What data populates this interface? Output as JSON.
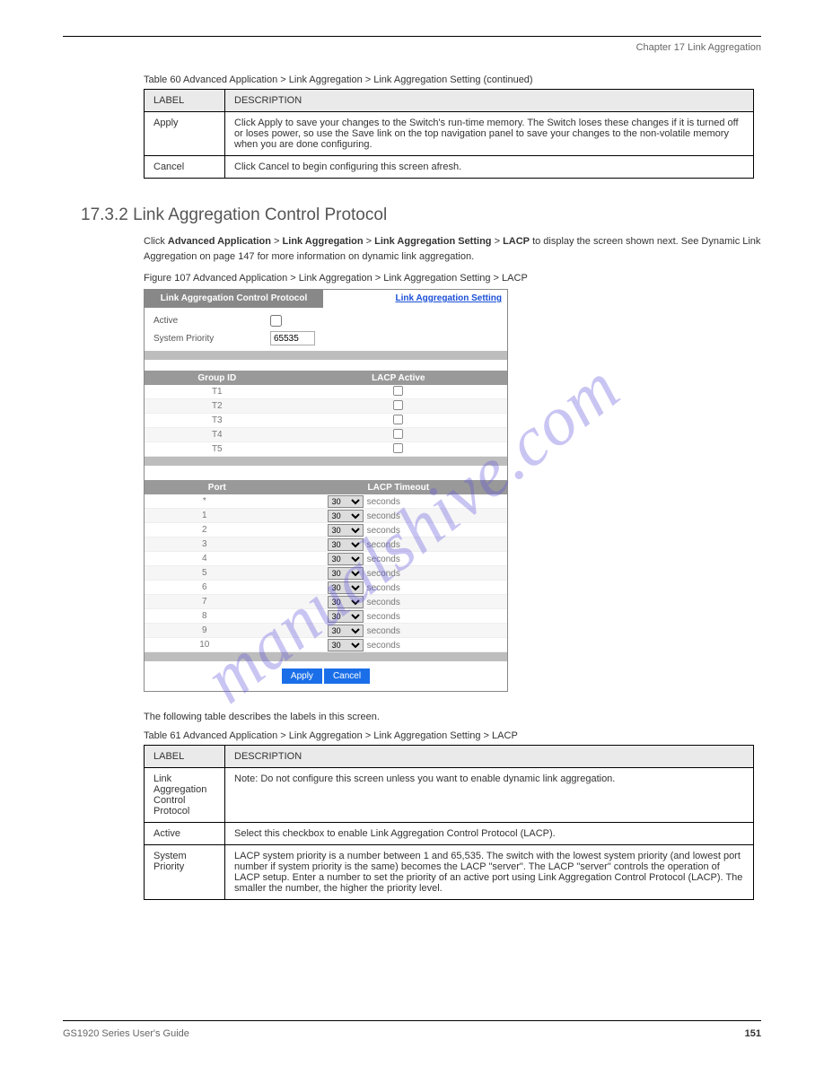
{
  "header": {
    "chapter": "Chapter 17 Link Aggregation"
  },
  "table_top": {
    "caption": "Table 60   Advanced Application > Link Aggregation > Link Aggregation Setting (continued)",
    "cols": [
      "LABEL",
      "DESCRIPTION"
    ],
    "rows": [
      {
        "label": "Apply",
        "desc": "Click Apply to save your changes to the Switch's run-time memory. The Switch loses these changes if it is turned off or loses power, so use the Save link on the top navigation panel to save your changes to the non-volatile memory when you are done configuring."
      },
      {
        "label": "Cancel",
        "desc": "Click Cancel to begin configuring this screen afresh."
      }
    ]
  },
  "section": {
    "number": "17.3.2  Link Aggregation Control Protocol",
    "body_before": "Click ",
    "body_bold1": "Advanced Application",
    "body_mid1": " > ",
    "body_bold2": "Link Aggregation",
    "body_mid2": " > ",
    "body_bold3": "Link Aggregation Setting",
    "body_mid3": " > ",
    "body_bold4": "LACP",
    "body_after": " to display the screen shown next. See ",
    "body_xref": "Dynamic Link Aggregation on page 147",
    "body_end": " for more information on dynamic link aggregation."
  },
  "figure": {
    "caption": "Figure 107   Advanced Application > Link Aggregation > Link Aggregation Setting > LACP"
  },
  "ui": {
    "title_left": "Link Aggregation Control Protocol",
    "title_right": "Link Aggregation Setting",
    "active_label": "Active",
    "system_priority_label": "System Priority",
    "system_priority_value": "65535",
    "group_table": {
      "headers": [
        "Group ID",
        "LACP Active"
      ],
      "rows": [
        "T1",
        "T2",
        "T3",
        "T4",
        "T5"
      ]
    },
    "port_table": {
      "headers": [
        "Port",
        "LACP Timeout"
      ],
      "timeout_value": "30",
      "unit": "seconds",
      "rows": [
        "*",
        "1",
        "2",
        "3",
        "4",
        "5",
        "6",
        "7",
        "8",
        "9",
        "10"
      ]
    },
    "apply": "Apply",
    "cancel": "Cancel"
  },
  "table_bottom": {
    "caption": "The following table describes the labels in this screen.",
    "title": "Table 61   Advanced Application > Link Aggregation > Link Aggregation Setting > LACP",
    "cols": [
      "LABEL",
      "DESCRIPTION"
    ],
    "rows": [
      {
        "label": "Link Aggregation Control Protocol",
        "desc": "Note: Do not configure this screen unless you want to enable dynamic link aggregation."
      },
      {
        "label": "Active",
        "desc": "Select this checkbox to enable Link Aggregation Control Protocol (LACP)."
      },
      {
        "label": "System Priority",
        "desc": "LACP system priority is a number between 1 and 65,535. The switch with the lowest system priority (and lowest port number if system priority is the same) becomes the LACP \"server\". The LACP \"server\" controls the operation of LACP setup. Enter a number to set the priority of an active port using Link Aggregation Control Protocol (LACP). The smaller the number, the higher the priority level."
      }
    ]
  },
  "footer": {
    "text": "GS1920 Series User's Guide",
    "page": "151"
  },
  "watermark": "manualshive.com"
}
